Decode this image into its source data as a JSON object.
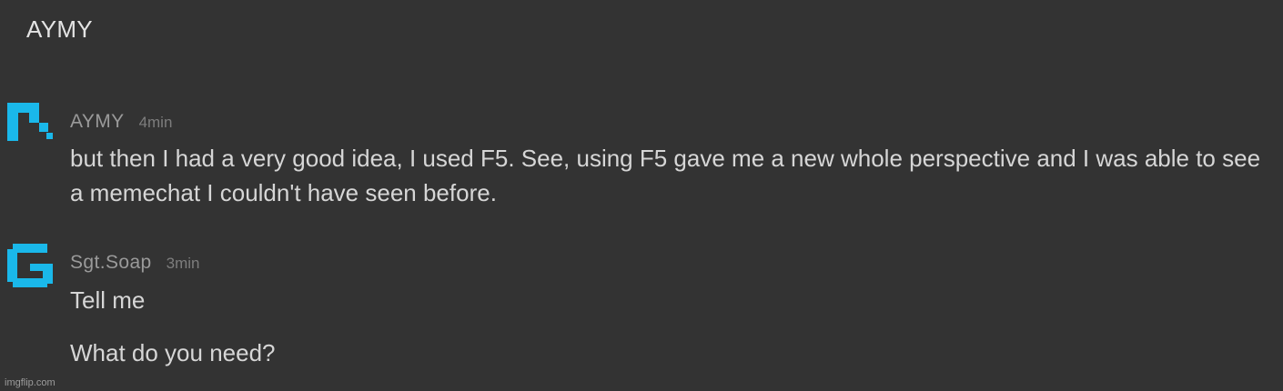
{
  "channel": {
    "title": "AYMY"
  },
  "messages": [
    {
      "author": "AYMY",
      "time": "4min",
      "avatar_icon": "pixel-pickaxe-icon",
      "lines": [
        "but then I had a very good idea, I used F5. See, using F5 gave me a new whole perspective and I was able to see a memechat I couldn't have seen before."
      ]
    },
    {
      "author": "Sgt.Soap",
      "time": "3min",
      "avatar_icon": "pixel-g-icon",
      "lines": [
        "Tell me",
        "What do you need?"
      ]
    }
  ],
  "colors": {
    "background": "#333333",
    "avatar_accent": "#1ab8ea"
  },
  "watermark": "imgflip.com"
}
